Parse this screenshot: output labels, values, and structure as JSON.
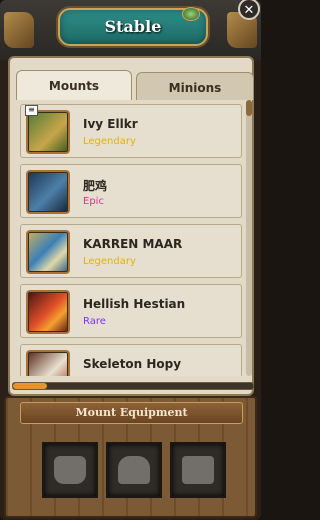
{
  "window": {
    "title": "Stable",
    "close_symbol": "✕"
  },
  "tabs": [
    {
      "label": "Mounts",
      "active": true
    },
    {
      "label": "Minions",
      "active": false
    }
  ],
  "mounts": [
    {
      "name": "Ivy Ellkr",
      "rarity": "Legendary",
      "rarity_color": "#e0b400",
      "icon": "ivy-ellkr-portrait",
      "equipped": true,
      "equipped_mark": "≡"
    },
    {
      "name": "肥鸡",
      "rarity": "Epic",
      "rarity_color": "#e0308a",
      "icon": "chicken-mount-portrait"
    },
    {
      "name": "KARREN MAAR",
      "rarity": "Legendary",
      "rarity_color": "#e0b400",
      "icon": "karren-maar-portrait"
    },
    {
      "name": "Hellish Hestian",
      "rarity": "Rare",
      "rarity_color": "#7a33ff",
      "icon": "hellish-hestian-portrait"
    },
    {
      "name": "Skeleton Hopy",
      "rarity": "",
      "rarity_color": "#999999",
      "icon": "skeleton-hopy-portrait"
    }
  ],
  "scroll_progress": 0.14,
  "equipment": {
    "title": "Mount Equipment",
    "slots": [
      {
        "icon": "saddle-armor-icon"
      },
      {
        "icon": "wing-harness-icon"
      },
      {
        "icon": "leg-armor-icon"
      }
    ]
  }
}
